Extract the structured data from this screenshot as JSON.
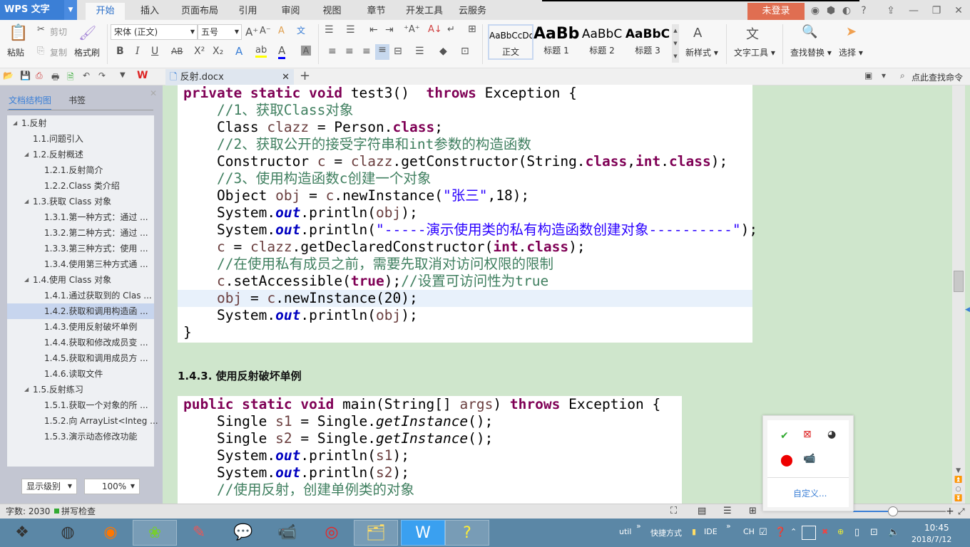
{
  "app": {
    "title": "WPS 文字",
    "login": "未登录",
    "window_buttons": [
      "minimize",
      "restore",
      "close"
    ]
  },
  "menu_tabs": [
    "开始",
    "插入",
    "页面布局",
    "引用",
    "审阅",
    "视图",
    "章节",
    "开发工具",
    "云服务"
  ],
  "ribbon": {
    "paste": "粘贴",
    "cut": "剪切",
    "copy": "复制",
    "format_painter": "格式刷",
    "font": "宋体 (正文)",
    "size": "五号",
    "styles": [
      {
        "preview": "AaBbCcDd",
        "label": "正文"
      },
      {
        "preview": "AaBb",
        "label": "标题 1"
      },
      {
        "preview": "AaBbC",
        "label": "标题 2"
      },
      {
        "preview": "AaBbC",
        "label": "标题 3"
      }
    ],
    "new_style": "新样式",
    "text_tools": "文字工具",
    "find_replace": "查找替换",
    "select": "选择",
    "search_cmd": "点此查找命令",
    "colors": {
      "highlight": "#ffff00",
      "font_color": "#0000ff"
    }
  },
  "doc_tab": {
    "name": "反射.docx"
  },
  "nav": {
    "tabs": [
      "文档结构图",
      "书签"
    ],
    "items": [
      {
        "label": "1.反射",
        "level": 1,
        "expand": true
      },
      {
        "label": "1.1.问题引入",
        "level": 2
      },
      {
        "label": "1.2.反射概述",
        "level": 2,
        "expand": true
      },
      {
        "label": "1.2.1.反射简介",
        "level": 3
      },
      {
        "label": "1.2.2.Class 类介绍",
        "level": 3
      },
      {
        "label": "1.3.获取 Class 对象",
        "level": 2,
        "expand": true
      },
      {
        "label": "1.3.1.第一种方式：通过 ...",
        "level": 3
      },
      {
        "label": "1.3.2.第二种方式：通过 ...",
        "level": 3
      },
      {
        "label": "1.3.3.第三种方式：使用 ...",
        "level": 3
      },
      {
        "label": "1.3.4.使用第三种方式通 ...",
        "level": 3
      },
      {
        "label": "1.4.使用 Class 对象",
        "level": 2,
        "expand": true
      },
      {
        "label": "1.4.1.通过获取到的 Clas ...",
        "level": 3
      },
      {
        "label": "1.4.2.获取和调用构造函 ...",
        "level": 3,
        "selected": true
      },
      {
        "label": "1.4.3.使用反射破坏单例",
        "level": 3
      },
      {
        "label": "1.4.4.获取和修改成员变 ...",
        "level": 3
      },
      {
        "label": "1.4.5.获取和调用成员方 ...",
        "level": 3
      },
      {
        "label": "1.4.6.读取文件",
        "level": 3
      },
      {
        "label": "1.5.反射练习",
        "level": 2,
        "expand": true
      },
      {
        "label": "1.5.1.获取一个对象的所 ...",
        "level": 3
      },
      {
        "label": "1.5.2.向 ArrayList<Integ ...",
        "level": 3
      },
      {
        "label": "1.5.3.演示动态修改功能",
        "level": 3
      }
    ],
    "level_select": "显示级别",
    "zoom_select": "100%"
  },
  "doc": {
    "code1": [
      [
        [
          "kw",
          "private static void "
        ],
        [
          "pl",
          "test3()  "
        ],
        [
          "kw",
          "throws "
        ],
        [
          "pl",
          "Exception {"
        ]
      ],
      [
        [
          "pl",
          "    "
        ],
        [
          "cm",
          "//1、获取Class对象"
        ]
      ],
      [
        [
          "pl",
          "    Class "
        ],
        [
          "var",
          "clazz"
        ],
        [
          "pl",
          " = Person."
        ],
        [
          "kw",
          "class"
        ],
        [
          "pl",
          ";"
        ]
      ],
      [
        [
          "pl",
          "    "
        ],
        [
          "cm",
          "//2、获取公开的接受字符串和int参数的构造函数"
        ]
      ],
      [
        [
          "pl",
          "    Constructor "
        ],
        [
          "var",
          "c"
        ],
        [
          "pl",
          " = "
        ],
        [
          "var",
          "clazz"
        ],
        [
          "pl",
          ".getConstructor(String."
        ],
        [
          "kw",
          "class"
        ],
        [
          "pl",
          ","
        ],
        [
          "kw",
          "int"
        ],
        [
          "pl",
          "."
        ],
        [
          "kw",
          "class"
        ],
        [
          "pl",
          ");"
        ]
      ],
      [
        [
          "pl",
          "    "
        ],
        [
          "cm",
          "//3、使用构造函数c创建一个对象"
        ]
      ],
      [
        [
          "pl",
          "    Object "
        ],
        [
          "var",
          "obj"
        ],
        [
          "pl",
          " = "
        ],
        [
          "var",
          "c"
        ],
        [
          "pl",
          ".newInstance("
        ],
        [
          "str",
          "\"张三\""
        ],
        [
          "pl",
          ",18);"
        ]
      ],
      [
        [
          "pl",
          "    System."
        ],
        [
          "fld",
          "out"
        ],
        [
          "pl",
          ".println("
        ],
        [
          "var",
          "obj"
        ],
        [
          "pl",
          ");"
        ]
      ],
      [
        [
          "pl",
          "    System."
        ],
        [
          "fld",
          "out"
        ],
        [
          "pl",
          ".println("
        ],
        [
          "str",
          "\"-----演示使用类的私有构造函数创建对象----------\""
        ],
        [
          "pl",
          ");"
        ]
      ],
      [
        [
          "pl",
          "    "
        ],
        [
          "var",
          "c"
        ],
        [
          "pl",
          " = "
        ],
        [
          "var",
          "clazz"
        ],
        [
          "pl",
          ".getDeclaredConstructor("
        ],
        [
          "kw",
          "int"
        ],
        [
          "pl",
          "."
        ],
        [
          "kw",
          "class"
        ],
        [
          "pl",
          ");"
        ]
      ],
      [
        [
          "pl",
          "    "
        ],
        [
          "cm",
          "//在使用私有成员之前，需要先取消对访问权限的限制"
        ]
      ],
      [
        [
          "pl",
          "    "
        ],
        [
          "var",
          "c"
        ],
        [
          "pl",
          ".setAccessible("
        ],
        [
          "kw",
          "true"
        ],
        [
          "pl",
          ");"
        ],
        [
          "cm",
          "//设置可访问性为true"
        ]
      ],
      [
        [
          "pl",
          "    "
        ],
        [
          "var",
          "obj"
        ],
        [
          "pl",
          " = "
        ],
        [
          "var",
          "c"
        ],
        [
          "pl",
          ".newInstance(20);"
        ]
      ],
      [
        [
          "pl",
          "    System."
        ],
        [
          "fld",
          "out"
        ],
        [
          "pl",
          ".println("
        ],
        [
          "var",
          "obj"
        ],
        [
          "pl",
          ");"
        ]
      ],
      [
        [
          "pl",
          "}"
        ]
      ]
    ],
    "heading": "1.4.3. 使用反射破坏单例",
    "code2": [
      [
        [
          "kw",
          "public static void "
        ],
        [
          "pl",
          "main(String[] "
        ],
        [
          "var",
          "args"
        ],
        [
          "pl",
          ") "
        ],
        [
          "kw",
          "throws "
        ],
        [
          "pl",
          "Exception {"
        ]
      ],
      [
        [
          "pl",
          "    Single "
        ],
        [
          "var",
          "s1"
        ],
        [
          "pl",
          " = Single."
        ],
        [
          "it",
          "getInstance"
        ],
        [
          "pl",
          "();"
        ]
      ],
      [
        [
          "pl",
          "    Single "
        ],
        [
          "var",
          "s2"
        ],
        [
          "pl",
          " = Single."
        ],
        [
          "it",
          "getInstance"
        ],
        [
          "pl",
          "();"
        ]
      ],
      [
        [
          "pl",
          "    System."
        ],
        [
          "fld",
          "out"
        ],
        [
          "pl",
          ".println("
        ],
        [
          "var",
          "s1"
        ],
        [
          "pl",
          ");"
        ]
      ],
      [
        [
          "pl",
          "    System."
        ],
        [
          "fld",
          "out"
        ],
        [
          "pl",
          ".println("
        ],
        [
          "var",
          "s2"
        ],
        [
          "pl",
          ");"
        ]
      ],
      [
        [
          "pl",
          "    "
        ],
        [
          "cm",
          "//使用反射，创建单例类的对象"
        ]
      ]
    ]
  },
  "status": {
    "word_count": "字数: 2030",
    "spell_check": "拼写检查"
  },
  "tray_popup": {
    "customize": "自定义..."
  },
  "taskbar": {
    "util": "util",
    "shortcut": "快捷方式",
    "ide": "IDE",
    "lang": "CH",
    "time": "10:45",
    "date": "2018/7/12"
  }
}
